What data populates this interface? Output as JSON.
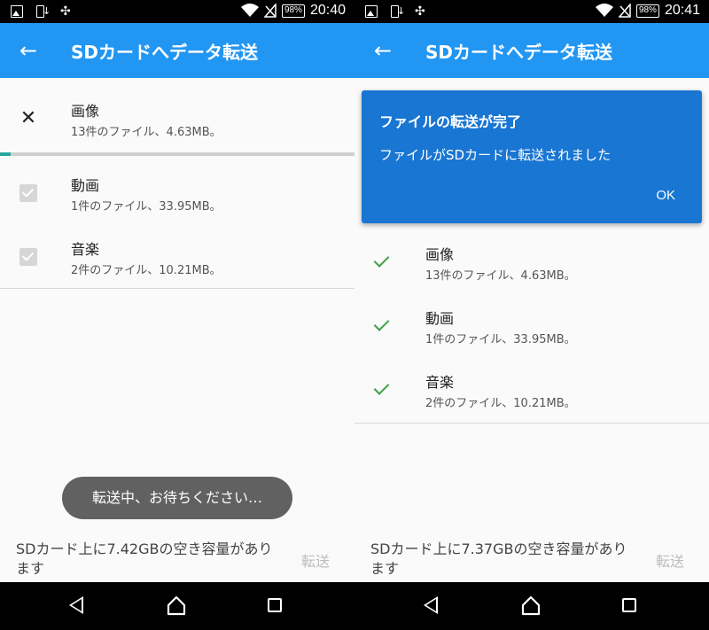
{
  "left": {
    "status": {
      "battery": "98%",
      "time": "20:40"
    },
    "appbar": {
      "back_icon": "arrow-back-icon",
      "title": "SDカードへデータ転送"
    },
    "items": [
      {
        "name": "画像",
        "detail": "13件のファイル、4.63MB。",
        "state": "cancel"
      },
      {
        "name": "動画",
        "detail": "1件のファイル、33.95MB。",
        "state": "checked-disabled"
      },
      {
        "name": "音楽",
        "detail": "2件のファイル、10.21MB。",
        "state": "checked-disabled"
      }
    ],
    "progress_fraction": 0.03,
    "toast": "転送中、お待ちください…",
    "footer": {
      "free_space": "SDカード上に7.42GBの空き容量があります",
      "transfer_label": "転送"
    }
  },
  "right": {
    "status": {
      "battery": "98%",
      "time": "20:41"
    },
    "appbar": {
      "back_icon": "arrow-back-icon",
      "title": "SDカードへデータ転送"
    },
    "dialog": {
      "title": "ファイルの転送が完了",
      "message": "ファイルがSDカードに転送されました",
      "ok_label": "OK"
    },
    "items": [
      {
        "name": "画像",
        "detail": "13件のファイル、4.63MB。",
        "state": "done"
      },
      {
        "name": "動画",
        "detail": "1件のファイル、33.95MB。",
        "state": "done"
      },
      {
        "name": "音楽",
        "detail": "2件のファイル、10.21MB。",
        "state": "done"
      }
    ],
    "footer": {
      "free_space": "SDカード上に7.37GBの空き容量があります",
      "transfer_label": "転送"
    }
  },
  "colors": {
    "appbar": "#2196f3",
    "dialog": "#1976d2",
    "progress": "#26a69a",
    "done_check": "#43a047"
  }
}
